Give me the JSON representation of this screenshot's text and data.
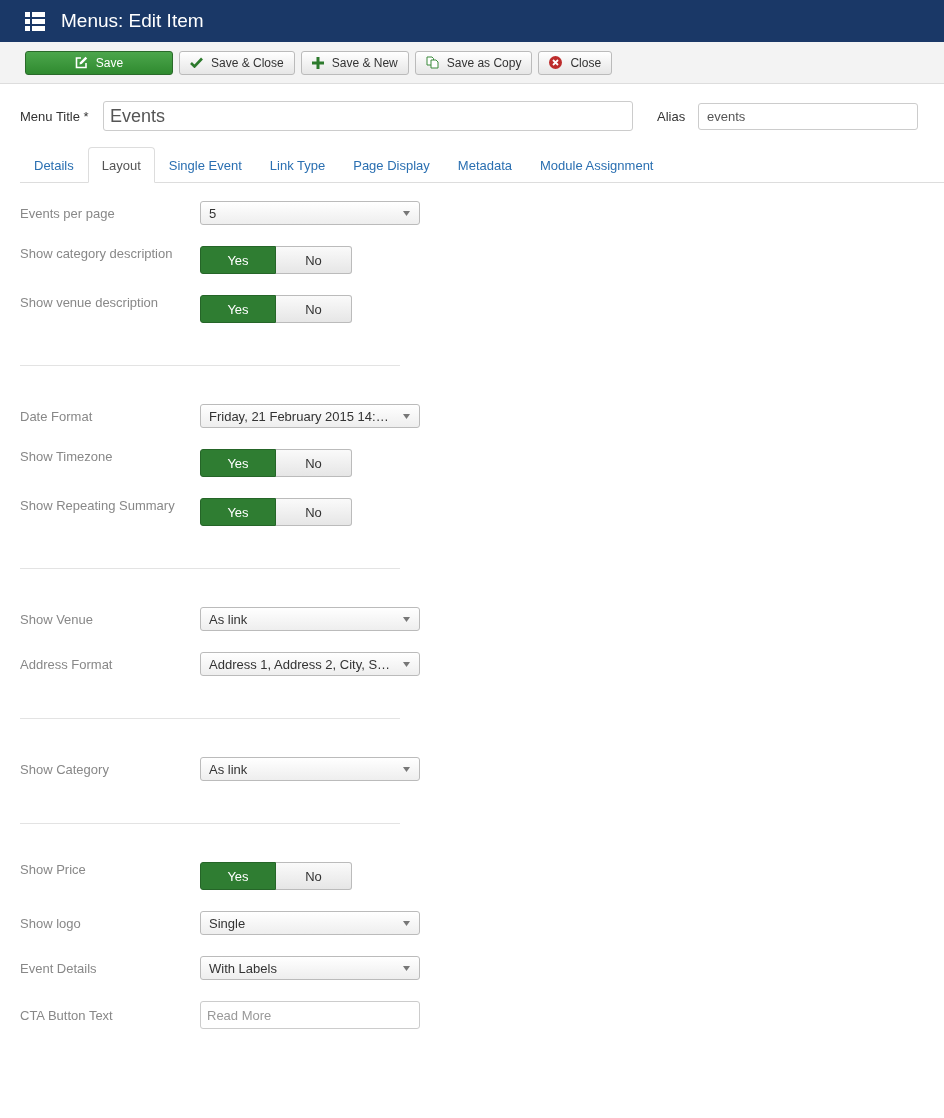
{
  "header": {
    "title": "Menus: Edit Item"
  },
  "toolbar": [
    {
      "kind": "save",
      "label": "Save"
    },
    {
      "kind": "apply",
      "label": "Save & Close"
    },
    {
      "kind": "new",
      "label": "Save & New"
    },
    {
      "kind": "copy",
      "label": "Save as Copy"
    },
    {
      "kind": "cancel",
      "label": "Close"
    }
  ],
  "title_field": {
    "label": "Menu Title *",
    "value": "Events"
  },
  "alias_field": {
    "label": "Alias",
    "value": "events"
  },
  "tabs": [
    {
      "label": "Details",
      "selected": false
    },
    {
      "label": "Layout",
      "selected": true
    },
    {
      "label": "Single Event",
      "selected": false
    },
    {
      "label": "Link Type",
      "selected": false
    },
    {
      "label": "Page Display",
      "selected": false
    },
    {
      "label": "Metadata",
      "selected": false
    },
    {
      "label": "Module Assignment",
      "selected": false
    }
  ],
  "groups": [
    {
      "fields": [
        {
          "kind": "select",
          "label": "Events per page",
          "value": "5"
        },
        {
          "kind": "toggle",
          "label": "Show category description",
          "options": [
            {
              "label": "Yes",
              "selected": true
            },
            {
              "label": "No",
              "selected": false
            }
          ]
        },
        {
          "kind": "toggle",
          "label": "Show venue description",
          "options": [
            {
              "label": "Yes",
              "selected": true
            },
            {
              "label": "No",
              "selected": false
            }
          ]
        }
      ]
    },
    {
      "fields": [
        {
          "kind": "select",
          "label": "Date Format",
          "value": "Friday, 21 February 2015 14:…"
        },
        {
          "kind": "toggle",
          "label": "Show Timezone",
          "options": [
            {
              "label": "Yes",
              "selected": true
            },
            {
              "label": "No",
              "selected": false
            }
          ]
        },
        {
          "kind": "toggle",
          "label": "Show Repeating Summary",
          "options": [
            {
              "label": "Yes",
              "selected": true
            },
            {
              "label": "No",
              "selected": false
            }
          ]
        }
      ]
    },
    {
      "fields": [
        {
          "kind": "select",
          "label": "Show Venue",
          "value": "As link"
        },
        {
          "kind": "select",
          "label": "Address Format",
          "value": "Address 1, Address 2, City, S…"
        }
      ]
    },
    {
      "fields": [
        {
          "kind": "select",
          "label": "Show Category",
          "value": "As link"
        }
      ]
    },
    {
      "fields": [
        {
          "kind": "toggle",
          "label": "Show Price",
          "options": [
            {
              "label": "Yes",
              "selected": true
            },
            {
              "label": "No",
              "selected": false
            }
          ]
        },
        {
          "kind": "select",
          "label": "Show logo",
          "value": "Single"
        },
        {
          "kind": "select",
          "label": "Event Details",
          "value": "With Labels"
        },
        {
          "kind": "text",
          "label": "CTA Button Text",
          "placeholder": "Read More"
        }
      ]
    }
  ]
}
